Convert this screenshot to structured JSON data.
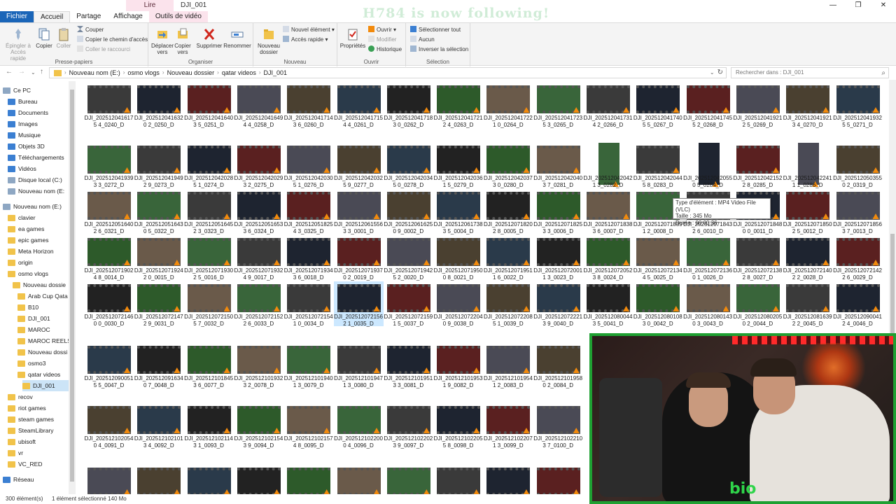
{
  "window": {
    "context_tab": "Lire",
    "title": "DJI_001",
    "overlay": "H784 is now following!"
  },
  "tabs": [
    "Fichier",
    "Accueil",
    "Partage",
    "Affichage",
    "Outils de vidéo"
  ],
  "ribbon": {
    "presse_papiers": {
      "name": "Presse-papiers",
      "pin": "Épingler à Accès rapide",
      "copy": "Copier",
      "paste": "Coller",
      "cut": "Couper",
      "copy_path": "Copier le chemin d'accès",
      "paste_shortcut": "Coller le raccourci"
    },
    "organiser": {
      "name": "Organiser",
      "move": "Déplacer vers",
      "copy_to": "Copier vers",
      "delete": "Supprimer",
      "rename": "Renommer"
    },
    "nouveau": {
      "name": "Nouveau",
      "new_folder": "Nouveau dossier",
      "new_item": "Nouvel élément",
      "quick_access": "Accès rapide"
    },
    "ouvrir": {
      "name": "Ouvrir",
      "properties": "Propriétés",
      "open": "Ouvrir",
      "edit": "Modifier",
      "history": "Historique"
    },
    "selection": {
      "name": "Sélection",
      "select_all": "Sélectionner tout",
      "none": "Aucun",
      "invert": "Inverser la sélection"
    }
  },
  "address": {
    "crumbs": [
      "Nouveau nom (E:)",
      "osmo vlogs",
      "Nouveau dossier",
      "qatar videos",
      "DJI_001"
    ],
    "search_placeholder": "Rechercher dans : DJI_001"
  },
  "nav": {
    "items": [
      {
        "label": "Ce PC",
        "indent": 0,
        "icon": "pc-icon"
      },
      {
        "label": "Bureau",
        "indent": 1,
        "icon": "desktop-icon"
      },
      {
        "label": "Documents",
        "indent": 1,
        "icon": "documents-icon"
      },
      {
        "label": "Images",
        "indent": 1,
        "icon": "images-icon"
      },
      {
        "label": "Musique",
        "indent": 1,
        "icon": "music-icon"
      },
      {
        "label": "Objets 3D",
        "indent": 1,
        "icon": "objects-3d-icon"
      },
      {
        "label": "Téléchargements",
        "indent": 1,
        "icon": "downloads-icon"
      },
      {
        "label": "Vidéos",
        "indent": 1,
        "icon": "videos-icon"
      },
      {
        "label": "Disque local (C:)",
        "indent": 1,
        "icon": "drive-icon"
      },
      {
        "label": "Nouveau nom (E:",
        "indent": 1,
        "icon": "drive-icon"
      },
      {
        "label": "",
        "indent": 0,
        "icon": "spacer"
      },
      {
        "label": "Nouveau nom (E:)",
        "indent": 0,
        "icon": "drive-icon"
      },
      {
        "label": "clavier",
        "indent": 1,
        "icon": "folder-icon"
      },
      {
        "label": "ea games",
        "indent": 1,
        "icon": "folder-icon"
      },
      {
        "label": "epic games",
        "indent": 1,
        "icon": "folder-icon"
      },
      {
        "label": "Meta Horizon",
        "indent": 1,
        "icon": "folder-icon"
      },
      {
        "label": "origin",
        "indent": 1,
        "icon": "folder-icon"
      },
      {
        "label": "osmo vlogs",
        "indent": 1,
        "icon": "folder-icon"
      },
      {
        "label": "Nouveau dossie",
        "indent": 2,
        "icon": "folder-icon"
      },
      {
        "label": "Arab Cup Qata",
        "indent": 3,
        "icon": "folder-icon"
      },
      {
        "label": "B10",
        "indent": 3,
        "icon": "folder-icon"
      },
      {
        "label": "DJI_001",
        "indent": 3,
        "icon": "folder-icon"
      },
      {
        "label": "MAROC",
        "indent": 3,
        "icon": "folder-icon"
      },
      {
        "label": "MAROC REELS",
        "indent": 3,
        "icon": "folder-icon"
      },
      {
        "label": "Nouveau dossi",
        "indent": 3,
        "icon": "folder-icon"
      },
      {
        "label": "osmo3",
        "indent": 3,
        "icon": "folder-icon"
      },
      {
        "label": "qatar videos",
        "indent": 3,
        "icon": "folder-icon"
      },
      {
        "label": "DJI_001",
        "indent": 4,
        "icon": "folder-icon",
        "selected": true
      },
      {
        "label": "recov",
        "indent": 1,
        "icon": "folder-icon"
      },
      {
        "label": "riot games",
        "indent": 1,
        "icon": "folder-icon"
      },
      {
        "label": "steam games",
        "indent": 1,
        "icon": "folder-icon"
      },
      {
        "label": "SteamLibrary",
        "indent": 1,
        "icon": "folder-icon"
      },
      {
        "label": "ubisoft",
        "indent": 1,
        "icon": "folder-icon"
      },
      {
        "label": "vr",
        "indent": 1,
        "icon": "folder-icon"
      },
      {
        "label": "VC_RED",
        "indent": 1,
        "icon": "folder-icon"
      },
      {
        "label": "",
        "indent": 0,
        "icon": "spacer"
      },
      {
        "label": "Réseau",
        "indent": 0,
        "icon": "network-icon"
      }
    ]
  },
  "files": {
    "rows": [
      [
        "DJI_2025120416175 4_0240_D",
        "DJI_2025120416320 2_0250_D",
        "DJI_2025120416403 5_0251_D",
        "DJI_2025120416494 4_0258_D",
        "DJI_2025120417143 6_0260_D",
        "DJI_2025120417154 4_0261_D",
        "DJI_2025120417183 0_0262_D",
        "DJI_2025120417212 4_0263_D",
        "DJI_2025120417221 0_0264_D",
        "DJI_2025120417235 3_0265_D",
        "DJI_2025120417314 2_0266_D",
        "DJI_2025120417405 5_0267_D",
        "DJI_2025120417455 2_0268_D",
        "DJI_2025120419212 5_0269_D",
        "DJI_2025120419213 4_0270_D",
        "DJI_2025120419325 5_0271_D"
      ],
      [
        "DJI_2025120419393 3_0272_D",
        "DJI_2025120419492 9_0273_D",
        "DJI_2025120420285 1_0274_D",
        "DJI_2025120420293 2_0275_D",
        "DJI_2025120420305 1_0276_D",
        "DJI_2025120420325 9_0277_D",
        "DJI_2025120420345 0_0278_D",
        "DJI_2025120420361 5_0279_D",
        "DJI_2025120420373 0_0280_D",
        "DJI_2025120420403 7_0281_D",
        "DJI_2025120420421 3_0282_D",
        "DJI_2025120420445 8_0283_D",
        "DJI_2025120420550 5_0284_D",
        "DJI_2025120421522 8_0285_D",
        "DJI_2025120422411 1_0286_D",
        "DJI_2025120503550 2_0319_D"
      ],
      [
        "DJI_2025120516402 6_0321_D",
        "DJI_2025120516430 5_0322_D",
        "DJI_2025120516452 3_0323_D",
        "DJI_2025120516533 6_0324_D",
        "DJI_2025120518254 3_0325_D",
        "DJI_2025120615563 3_0001_D",
        "DJI_2025120616250 9_0002_D",
        "DJI_2025120617383 5_0004_D",
        "DJI_2025120718202 8_0005_D",
        "DJI_2025120718253 3_0006_D",
        "DJI_2025120718383 6_0007_D",
        "DJI_2025120718391 2_0008_D",
        "DJI_2025120718432 6_0010_D",
        "DJI_2025120718480 0_0011_D",
        "DJI_2025120718502 5_0012_D",
        "DJI_2025120718563 7_0013_D"
      ],
      [
        "DJI_2025120719024 8_0014_D",
        "DJI_2025120719242 0_0015_D",
        "DJI_2025120719302 5_0016_D",
        "DJI_2025120719324 9_0017_D",
        "DJI_2025120719343 6_0018_D",
        "DJI_2025120719370 2_0019_D",
        "DJI_2025120719425 2_0020_D",
        "DJI_2025120719500 8_0021_D",
        "DJI_2025120719511 6_0022_D",
        "DJI_2025120720011 3_0023_D",
        "DJI_2025120720523 8_0024_D",
        "DJI_2025120721344 5_0025_D",
        "DJI_2025120721360 1_0026_D",
        "DJI_2025120721382 8_0027_D",
        "DJI_2025120721402 2_0028_D",
        "DJI_2025120721422 6_0029_D"
      ],
      [
        "DJI_2025120721460 0_0030_D",
        "DJI_2025120721472 9_0031_D",
        "DJI_2025120721505 7_0032_D",
        "DJI_2025120721522 6_0033_D",
        "DJI_2025120721541 0_0034_D",
        "DJI_2025120721562 1_0035_D",
        "DJI_2025120721591 5_0037_D",
        "DJI_2025120722040 9_0038_D",
        "DJI_2025120722085 1_0039_D",
        "DJI_2025120722213 9_0040_D",
        "DJI_2025120800443 5_0041_D",
        "DJI_2025120801083 0_0042_D",
        "DJI_2025120801430 3_0043_D",
        "DJI_2025120802050 2_0044_D",
        "DJI_2025120816392 2_0045_D",
        "DJI_2025120900412 4_0046_D"
      ],
      [
        "DJI_2025120900515 5_0047_D",
        "DJI_2025120916340 7_0048_D",
        "DJI_2025121018453 6_0077_D",
        "DJI_2025121019323 2_0078_D",
        "DJI_2025121019401 3_0079_D",
        "DJI_2025121019471 3_0080_D",
        "DJI_2025121019513 3_0081_D",
        "DJI_2025121019531 9_0082_D",
        "DJI_2025121019541 2_0083_D",
        "DJI_2025121019580 2_0084_D"
      ],
      [
        "DJI_2025121020540 4_0091_D",
        "DJI_2025121021013 4_0092_D",
        "DJI_2025121021143 1_0093_D",
        "DJI_2025121021543 9_0094_D",
        "DJI_2025121021574 8_0095_D",
        "DJI_2025121022000 4_0096_D",
        "DJI_2025121022023 9_0097_D",
        "DJI_2025121022055 8_0098_D",
        "DJI_2025121022071 3_0099_D",
        "DJI_2025121022103 7_0100_D"
      ],
      [
        "",
        "",
        "",
        "",
        "",
        "",
        "",
        "",
        "",
        ""
      ]
    ],
    "selected_index": [
      4,
      5
    ],
    "portrait": [
      [
        1,
        10
      ],
      [
        1,
        12
      ],
      [
        1,
        14
      ]
    ]
  },
  "tooltip": {
    "type": "Type d'élément : MP4 Video File (VLC)",
    "size": "Taille : 345 Mo",
    "duration": "Durée : 00:00:36"
  },
  "status": {
    "count": "300 élément(s)",
    "selection": "1 élément sélectionné  140 Mo"
  },
  "webcam": {
    "logo": "bio"
  },
  "colors": {
    "accent": "#1a65b8",
    "selection": "#cce8ff",
    "webcam_border": "#1fa032",
    "context_tab": "#fbe3ec"
  }
}
